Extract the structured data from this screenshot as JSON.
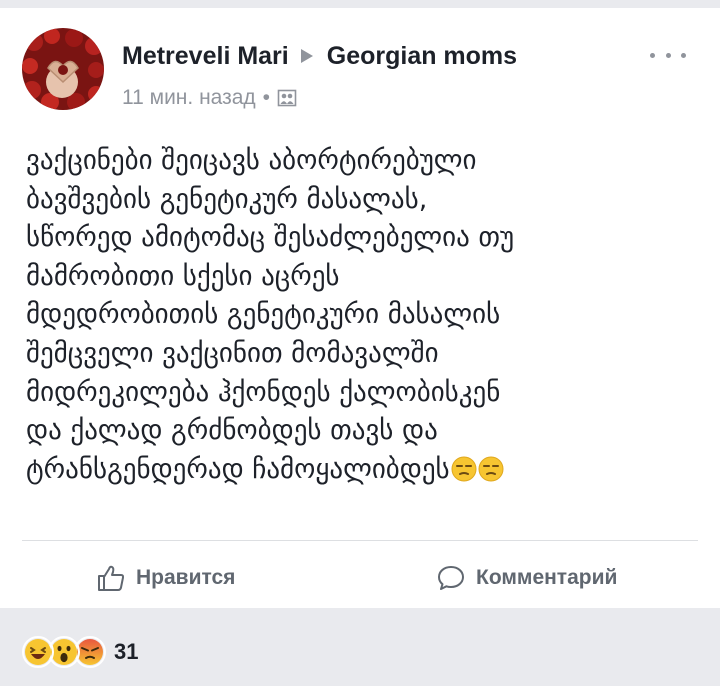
{
  "post": {
    "author": "Metreveli Mari",
    "group": "Georgian moms",
    "time": "11 мин. назад",
    "separator": "•",
    "privacy_icon": "group-icon",
    "more_icon": "more-options-icon",
    "text_lines": [
      "ვაქცინები შეიცავს აბორტირებული",
      "ბავშვების გენეტიკურ მასალას,",
      "სწორედ ამიტომაც შესაძლებელია  თუ",
      "მამრობითი სქესი აცრეს",
      "მდედრობითის გენეტიკური მასალის",
      "შემცველი ვაქცინით მომავალში",
      "მიდრეკილება ჰქონდეს ქალობისკენ",
      "და ქალად გრძნობდეს თავს და",
      "ტრანსგენდერად ჩამოყალიბდეს"
    ],
    "trailing_emojis": [
      "unamused-face-emoji",
      "unamused-face-emoji"
    ]
  },
  "actions": {
    "like_label": "Нравится",
    "like_icon": "thumbs-up-icon",
    "comment_label": "Комментарий",
    "comment_icon": "comment-bubble-icon"
  },
  "reactions": {
    "icons": [
      "haha-reaction",
      "wow-reaction",
      "angry-reaction"
    ],
    "count": "31"
  },
  "colors": {
    "background": "#e9eaee",
    "card": "#ffffff",
    "secondary_text": "#90949c",
    "action_text": "#606770",
    "emoji_yellow": "#f7c531",
    "angry_red": "#e9573f"
  }
}
